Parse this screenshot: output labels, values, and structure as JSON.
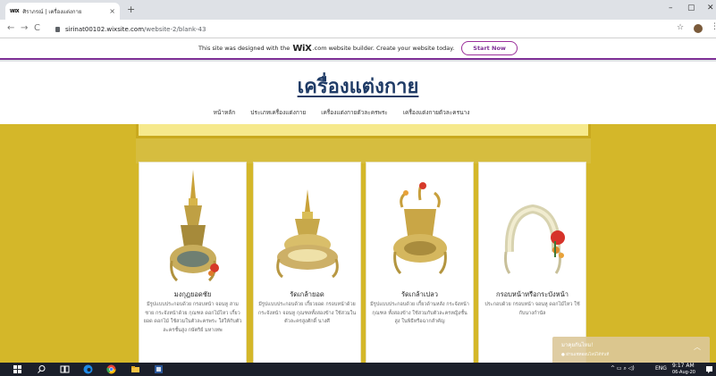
{
  "browser": {
    "tab_favicon": "WIX",
    "tab_title": "ศิราภรณ์ | เครื่องแต่งกาย",
    "tab_close": "×",
    "new_tab": "+",
    "window_minimize": "–",
    "window_maximize": "▢",
    "window_close": "✕",
    "nav_back": "←",
    "nav_forward": "→",
    "nav_reload": "C",
    "url_domain": "sirinat00102.wixsite.com",
    "url_path": "/website-2/blank-43",
    "bookmark_star": "☆",
    "menu_kebab": "⋮"
  },
  "wix_banner": {
    "text_before": "This site was designed with the",
    "brand": "WiX",
    "text_after": ".com website builder. Create your website today.",
    "button_label": "Start Now"
  },
  "site": {
    "title": "เครื่องแต่งกาย",
    "nav": [
      "หน้าหลัก",
      "ประเภทเครื่องแต่งกาย",
      "เครื่องแต่งกายตัวละครพระ",
      "เครื่องแต่งกายตัวละครนาง"
    ]
  },
  "products": [
    {
      "title": "มงกุฎยอดชัย",
      "desc": "มีรูปแบบประกอบด้วย กรอบหน้า จอนหู สามชาย กระจังหน้าด้วย กุณฑล ดอกไม้ไหว เกี้ยวยอด ดอกไม้ ใช้สวมในตัวละครพระ ใส่ให้กับตัวละครชั้นสูง กษัตริย์ มหาเทพ"
    },
    {
      "title": "รัดเกล้ายอด",
      "desc": "มีรูปแบบประกอบด้วย เกี้ยวยอด กรอบหน้าด้วย กระจังหน้า จอนหู กุณฑลทั้งสองข้าง ใช้สวมในตัวละครสูงศักดิ์ นางศี"
    },
    {
      "title": "รัดเกล้าเปลว",
      "desc": "มีรูปแบบประกอบด้วย เกี้ยวด้านหลัง กระจังหน้า กุณฑล ทั้งสองข้าง ใช้สวมกับตัวละครหญิงชั้นสูง ในพิธีหรือฉากสำคัญ"
    },
    {
      "title": "กรอบหน้าหรือกระบังหน้า",
      "desc": "ประกอบด้วย กรอบหน้า จอนหู ดอกไม้ไหว ใช้กับนางกำนัล"
    }
  ],
  "toast": {
    "title": "มาคุยกันไหม!",
    "subtitle": "● ผ่านแชทออนไลน์ได้ทันที"
  },
  "taskbar": {
    "clock_time": "9:17 AM",
    "clock_date": "06-Aug-20",
    "language": "ENG"
  },
  "colors": {
    "page_yellow": "#d4b729",
    "title_navy": "#1f3b66",
    "wix_purple": "#7e2f96"
  }
}
